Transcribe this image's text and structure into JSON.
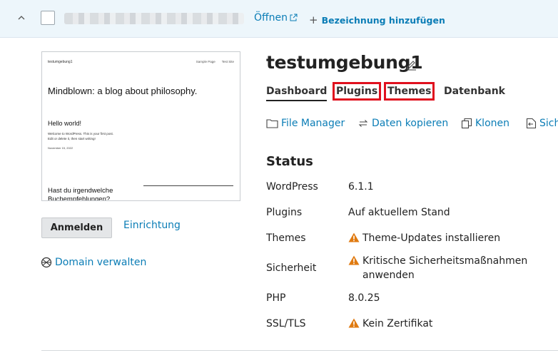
{
  "header": {
    "open_label": "Öffnen",
    "add_label": "Bezeichnung hinzufügen"
  },
  "preview": {
    "site_name": "testumgebung1",
    "nav": [
      "Sample Page",
      "Test Site"
    ],
    "headline": "Mindblown: a blog about philosophy.",
    "post_title": "Hello world!",
    "post_excerpt": "Welcome to WordPress. This is your first post. Edit or delete it, then start writing!",
    "post_date": "November 15, 2022",
    "question": "Hast du irgendwelche Buchempfehlungen?"
  },
  "actions_left": {
    "login_label": "Anmelden",
    "setup_label": "Einrichtung",
    "domain_label": "Domain verwalten"
  },
  "site": {
    "title": "testumgebung1"
  },
  "tabs": [
    {
      "label": "Dashboard"
    },
    {
      "label": "Plugins"
    },
    {
      "label": "Themes"
    },
    {
      "label": "Datenbank"
    }
  ],
  "toolbar": [
    {
      "label": "File Manager",
      "icon": "folder-icon"
    },
    {
      "label": "Daten kopieren",
      "icon": "sync-icon"
    },
    {
      "label": "Klonen",
      "icon": "clone-icon"
    },
    {
      "label": "Sich",
      "icon": "backup-icon"
    }
  ],
  "status": {
    "title": "Status",
    "rows": [
      {
        "label": "WordPress",
        "value": "6.1.1"
      },
      {
        "label": "Plugins",
        "value": "Auf aktuellem Stand"
      },
      {
        "label": "Themes",
        "value": "Theme-Updates installieren"
      },
      {
        "label": "Sicherheit",
        "value": "Kritische Sicherheitsmaßnahmen anwenden"
      },
      {
        "label": "PHP",
        "value": "8.0.25"
      },
      {
        "label": "SSL/TLS",
        "value": "Kein Zertifikat"
      }
    ]
  },
  "colors": {
    "link": "#0b7db6",
    "warning": "#e07a10",
    "highlight": "#e0101e",
    "header_bg": "#edf6fb"
  }
}
